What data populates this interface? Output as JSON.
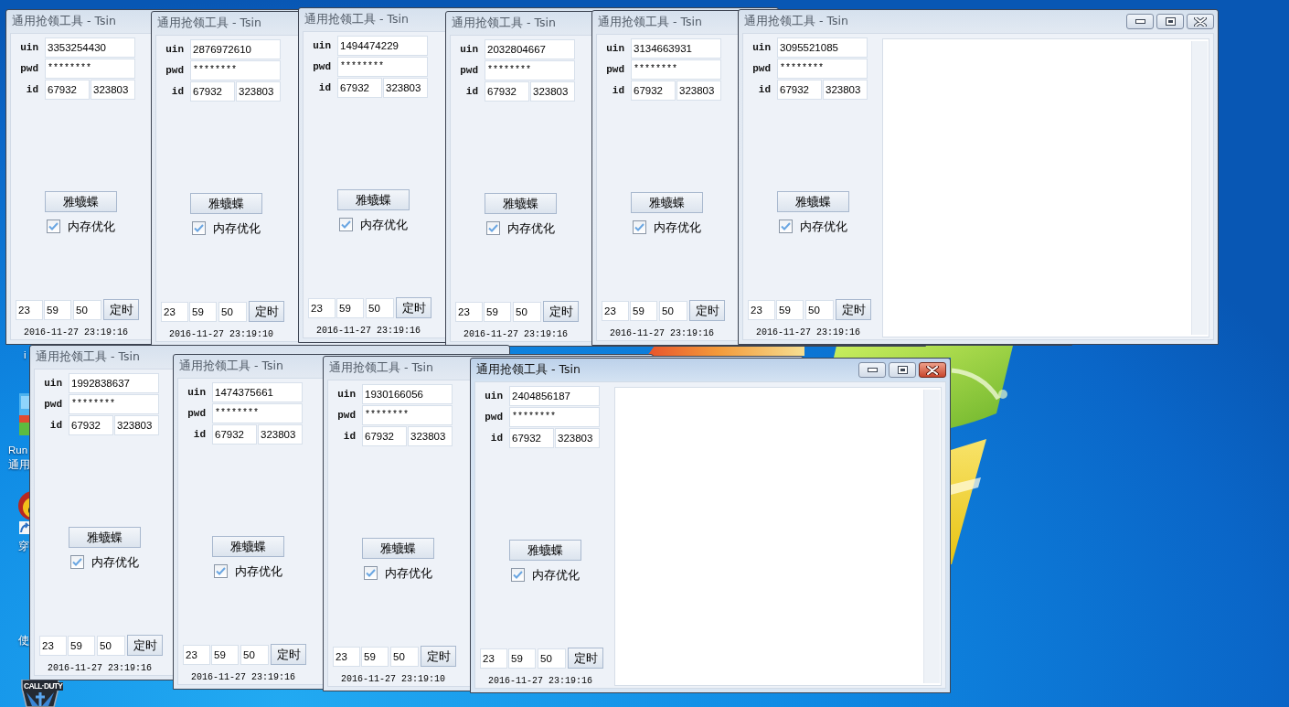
{
  "desktop": {
    "icons": [
      {
        "kind": "label_only",
        "label": "i"
      },
      {
        "kind": "blocks",
        "label": "Run 通用"
      },
      {
        "kind": "disc",
        "label": "穿"
      },
      {
        "kind": "label_only",
        "label": "使"
      },
      {
        "kind": "shield",
        "emblem_text": "CALL·DUTY"
      }
    ]
  },
  "windows": [
    {
      "kind": "behind",
      "active": false,
      "title": "通用抢领工具 - Tsin",
      "uin_label": "uin",
      "uin": "3353254430",
      "pwd_label": "pwd",
      "pwd": "********",
      "id_label": "id",
      "id": [
        "67932",
        "323803"
      ],
      "action_button": "雅蠛蝶",
      "memory_option": {
        "label": "内存优化",
        "checked": true
      },
      "time": [
        "23",
        "59",
        "50"
      ],
      "timer_button": "定时",
      "timestamp": "2016-11-27 23:19:16"
    },
    {
      "kind": "behind",
      "active": false,
      "title": "通用抢领工具 - Tsin",
      "uin_label": "uin",
      "uin": "2876972610",
      "pwd_label": "pwd",
      "pwd": "********",
      "id_label": "id",
      "id": [
        "67932",
        "323803"
      ],
      "action_button": "雅蠛蝶",
      "memory_option": {
        "label": "内存优化",
        "checked": true
      },
      "time": [
        "23",
        "59",
        "50"
      ],
      "timer_button": "定时",
      "timestamp": "2016-11-27 23:19:10"
    },
    {
      "kind": "behind",
      "active": false,
      "title": "通用抢领工具 - Tsin",
      "uin_label": "uin",
      "uin": "1494474229",
      "pwd_label": "pwd",
      "pwd": "********",
      "id_label": "id",
      "id": [
        "67932",
        "323803"
      ],
      "action_button": "雅蠛蝶",
      "memory_option": {
        "label": "内存优化",
        "checked": true
      },
      "time": [
        "23",
        "59",
        "50"
      ],
      "timer_button": "定时",
      "timestamp": "2016-11-27 23:19:16"
    },
    {
      "kind": "behind",
      "active": false,
      "title": "通用抢领工具 - Tsin",
      "uin_label": "uin",
      "uin": "2032804667",
      "pwd_label": "pwd",
      "pwd": "********",
      "id_label": "id",
      "id": [
        "67932",
        "323803"
      ],
      "action_button": "雅蠛蝶",
      "memory_option": {
        "label": "内存优化",
        "checked": true
      },
      "time": [
        "23",
        "59",
        "50"
      ],
      "timer_button": "定时",
      "timestamp": "2016-11-27 23:19:16"
    },
    {
      "kind": "behind",
      "active": false,
      "title": "通用抢领工具 - Tsin",
      "uin_label": "uin",
      "uin": "3134663931",
      "pwd_label": "pwd",
      "pwd": "********",
      "id_label": "id",
      "id": [
        "67932",
        "323803"
      ],
      "action_button": "雅蠛蝶",
      "memory_option": {
        "label": "内存优化",
        "checked": true
      },
      "time": [
        "23",
        "59",
        "50"
      ],
      "timer_button": "定时",
      "timestamp": "2016-11-27 23:19:16"
    },
    {
      "kind": "front",
      "active": false,
      "title": "通用抢领工具 - Tsin",
      "uin_label": "uin",
      "uin": "3095521085",
      "pwd_label": "pwd",
      "pwd": "********",
      "id_label": "id",
      "id": [
        "67932",
        "323803"
      ],
      "action_button": "雅蠛蝶",
      "memory_option": {
        "label": "内存优化",
        "checked": true
      },
      "time": [
        "23",
        "59",
        "50"
      ],
      "timer_button": "定时",
      "timestamp": "2016-11-27 23:19:16"
    },
    {
      "kind": "behind",
      "active": false,
      "title": "通用抢领工具 - Tsin",
      "uin_label": "uin",
      "uin": "1992838637",
      "pwd_label": "pwd",
      "pwd": "********",
      "id_label": "id",
      "id": [
        "67932",
        "323803"
      ],
      "action_button": "雅蠛蝶",
      "memory_option": {
        "label": "内存优化",
        "checked": true
      },
      "time": [
        "23",
        "59",
        "50"
      ],
      "timer_button": "定时",
      "timestamp": "2016-11-27 23:19:16"
    },
    {
      "kind": "behind",
      "active": false,
      "title": "通用抢领工具 - Tsin",
      "uin_label": "uin",
      "uin": "1474375661",
      "pwd_label": "pwd",
      "pwd": "********",
      "id_label": "id",
      "id": [
        "67932",
        "323803"
      ],
      "action_button": "雅蠛蝶",
      "memory_option": {
        "label": "内存优化",
        "checked": true
      },
      "time": [
        "23",
        "59",
        "50"
      ],
      "timer_button": "定时",
      "timestamp": "2016-11-27 23:19:16"
    },
    {
      "kind": "behind",
      "active": false,
      "title": "通用抢领工具 - Tsin",
      "uin_label": "uin",
      "uin": "1930166056",
      "pwd_label": "pwd",
      "pwd": "********",
      "id_label": "id",
      "id": [
        "67932",
        "323803"
      ],
      "action_button": "雅蠛蝶",
      "memory_option": {
        "label": "内存优化",
        "checked": true
      },
      "time": [
        "23",
        "59",
        "50"
      ],
      "timer_button": "定时",
      "timestamp": "2016-11-27 23:19:10"
    },
    {
      "kind": "front",
      "active": true,
      "title": "通用抢领工具 - Tsin",
      "uin_label": "uin",
      "uin": "2404856187",
      "pwd_label": "pwd",
      "pwd": "********",
      "id_label": "id",
      "id": [
        "67932",
        "323803"
      ],
      "action_button": "雅蠛蝶",
      "memory_option": {
        "label": "内存优化",
        "checked": true
      },
      "time": [
        "23",
        "59",
        "50"
      ],
      "timer_button": "定时",
      "timestamp": "2016-11-27 23:19:16"
    }
  ]
}
